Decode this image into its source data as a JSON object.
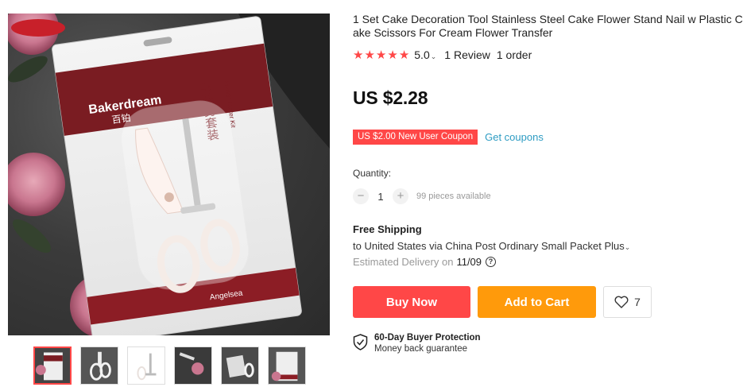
{
  "product": {
    "title": "1 Set Cake Decoration Tool Stainless Steel Cake Flower Stand Nail w Plastic Cake Scissors For Cream Flower Transfer",
    "rating": "5.0",
    "reviews": "1 Review",
    "orders": "1 order",
    "price": "US $2.28"
  },
  "image": {
    "brand": "Bakerdream",
    "brand_cn": "百铂",
    "package_cn": "裱花剪套装",
    "package_en": "Flower Cutter Kit",
    "footer_brand": "Angelsea"
  },
  "coupon": {
    "badge": "US $2.00 New User Coupon",
    "link": "Get coupons"
  },
  "quantity": {
    "label": "Quantity:",
    "minus": "−",
    "plus": "+",
    "value": "1",
    "available": "99 pieces available"
  },
  "shipping": {
    "title": "Free Shipping",
    "line": "to United States via China Post Ordinary Small Packet Plus",
    "delivery_label": "Estimated Delivery on",
    "delivery_date": "11/09"
  },
  "actions": {
    "buy_now": "Buy Now",
    "add_to_cart": "Add to Cart",
    "wishlist_count": "7"
  },
  "protection": {
    "title": "60-Day Buyer Protection",
    "subtitle": "Money back guarantee"
  },
  "colors": {
    "accent": "#ff4747",
    "cart": "#ff9a0b",
    "link": "#2e9cc3"
  }
}
